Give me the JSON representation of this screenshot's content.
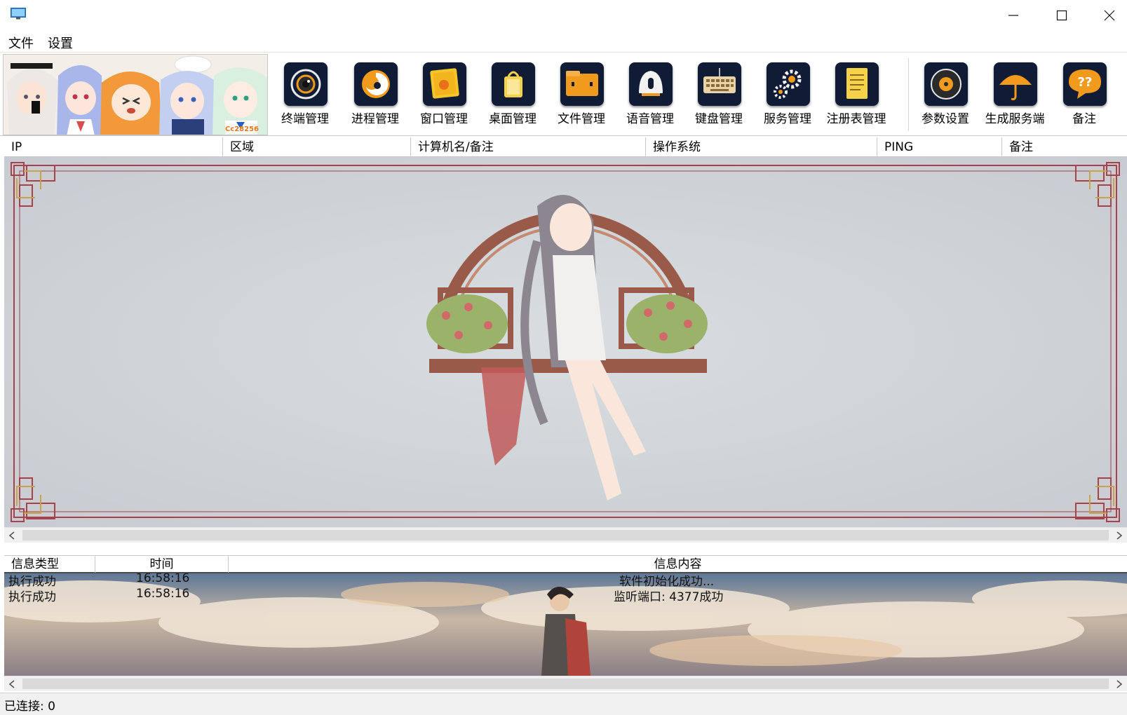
{
  "window": {
    "app_icon": "monitor-icon",
    "controls": [
      "minimize-icon",
      "maximize-icon",
      "close-icon"
    ]
  },
  "menu": {
    "items": [
      {
        "label": "文件"
      },
      {
        "label": "设置"
      }
    ]
  },
  "toolbar": {
    "banner_signature": "Cc28256",
    "buttons": [
      {
        "label": "终端管理",
        "icon": "terminal-eye-icon",
        "color": "#101b35"
      },
      {
        "label": "进程管理",
        "icon": "process-swirl-icon",
        "color": "#101b35"
      },
      {
        "label": "窗口管理",
        "icon": "window-note-icon",
        "color": "#101b35"
      },
      {
        "label": "桌面管理",
        "icon": "desktop-bag-icon",
        "color": "#101b35"
      },
      {
        "label": "文件管理",
        "icon": "folder-icon",
        "color": "#101b35"
      },
      {
        "label": "语音管理",
        "icon": "microphone-icon",
        "color": "#101b35"
      },
      {
        "label": "键盘管理",
        "icon": "keyboard-icon",
        "color": "#101b35"
      },
      {
        "label": "服务管理",
        "icon": "gears-icon",
        "color": "#101b35"
      },
      {
        "label": "注册表管理",
        "icon": "registry-doc-icon",
        "color": "#101b35"
      },
      {
        "label": "参数设置",
        "icon": "settings-disc-icon",
        "color": "#101b35"
      },
      {
        "label": "生成服务端",
        "icon": "umbrella-icon",
        "color": "#101b35"
      },
      {
        "label": "备注",
        "icon": "help-bubble-icon",
        "color": "#101b35"
      }
    ]
  },
  "client_list": {
    "columns": [
      "IP",
      "区域",
      "计算机名/备注",
      "操作系统",
      "PING",
      "备注"
    ],
    "rows": []
  },
  "log": {
    "columns": [
      "信息类型",
      "时间",
      "信息内容"
    ],
    "rows": [
      {
        "type": "执行成功",
        "time": "16:58:16",
        "message": "软件初始化成功..."
      },
      {
        "type": "执行成功",
        "time": "16:58:16",
        "message": "监听端口: 4377成功"
      }
    ]
  },
  "status": {
    "connected_text": "已连接: 0"
  },
  "colors": {
    "icon_tile": "#101b35",
    "icon_accent": "#f29a1b",
    "frame_red": "#a8414a",
    "frame_gold": "#c9a24a"
  }
}
